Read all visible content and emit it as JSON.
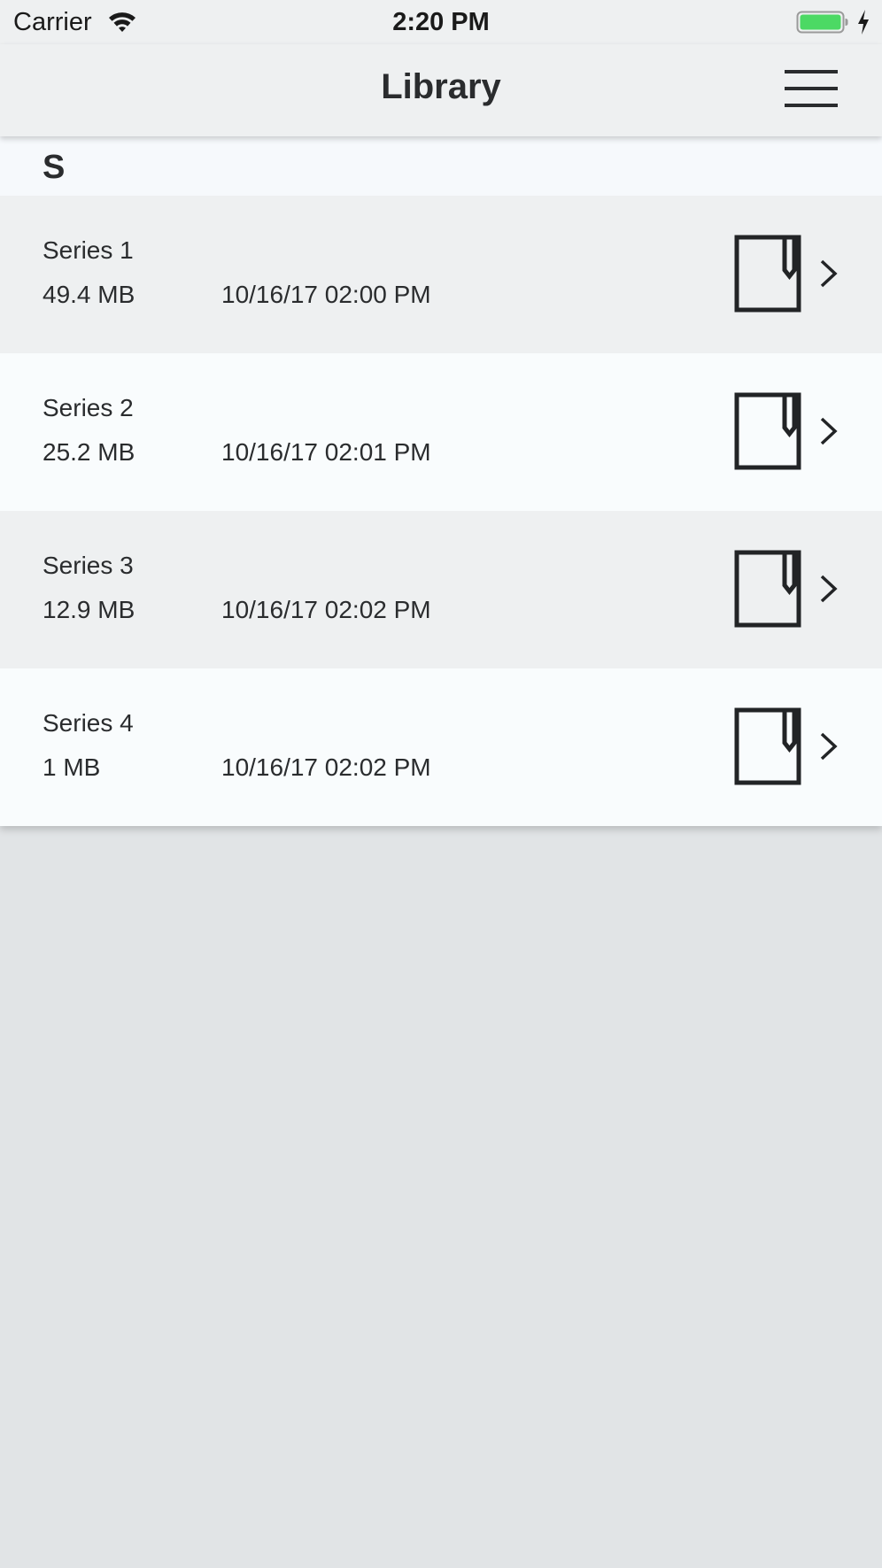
{
  "status_bar": {
    "carrier": "Carrier",
    "time": "2:20 PM"
  },
  "nav": {
    "title": "Library"
  },
  "section": {
    "letter": "S"
  },
  "items": [
    {
      "name": "Series 1",
      "size": "49.4 MB",
      "date": "10/16/17 02:00 PM"
    },
    {
      "name": "Series 2",
      "size": "25.2 MB",
      "date": "10/16/17 02:01 PM"
    },
    {
      "name": "Series 3",
      "size": "12.9 MB",
      "date": "10/16/17 02:02 PM"
    },
    {
      "name": "Series 4",
      "size": "1 MB",
      "date": "10/16/17 02:02 PM"
    }
  ],
  "icons": {
    "wifi": "wifi-icon",
    "battery": "battery-icon",
    "charging": "charging-bolt-icon",
    "menu": "hamburger-menu-icon",
    "file": "file-icon",
    "chevron": "chevron-right-icon"
  },
  "colors": {
    "battery_fill": "#4cd964",
    "bar_background": "#eef0f1",
    "row_alt_background": "#f9fcfd",
    "page_background": "#e1e4e6"
  }
}
